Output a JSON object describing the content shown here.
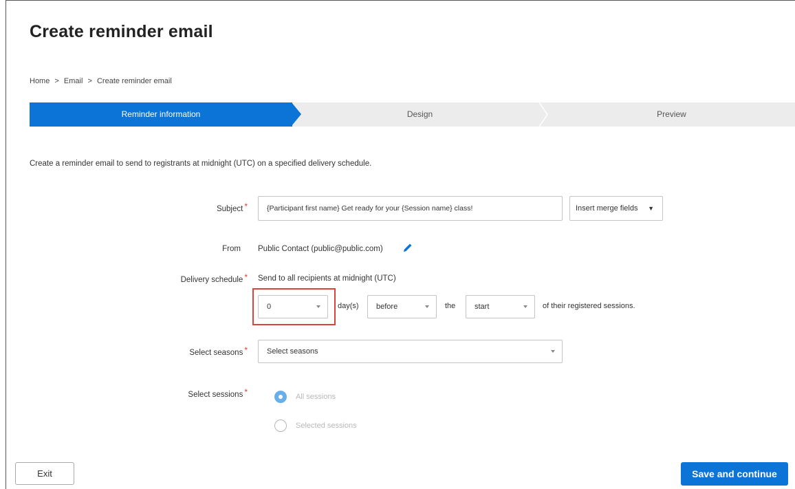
{
  "header": {
    "title": "Create reminder email"
  },
  "breadcrumb": {
    "items": [
      "Home",
      "Email",
      "Create reminder email"
    ],
    "separator": ">"
  },
  "stepper": {
    "steps": [
      {
        "label": "Reminder information",
        "active": true
      },
      {
        "label": "Design",
        "active": false
      },
      {
        "label": "Preview",
        "active": false
      }
    ]
  },
  "intro": "Create a reminder email to send to registrants at midnight (UTC) on a specified delivery schedule.",
  "form": {
    "subject": {
      "label": "Subject",
      "value": "{Participant first name} Get ready for your {Session name} class!",
      "merge_button": "Insert merge fields"
    },
    "from": {
      "label": "From",
      "value": "Public Contact (public@public.com)"
    },
    "delivery": {
      "label": "Delivery schedule",
      "description": "Send to all recipients at midnight (UTC)",
      "days_value": "0",
      "days_label": "day(s)",
      "relation_value": "before",
      "the_label": "the",
      "point_value": "start",
      "suffix": "of their registered sessions."
    },
    "seasons": {
      "label": "Select seasons",
      "placeholder": "Select seasons"
    },
    "sessions": {
      "label": "Select sessions",
      "options": [
        {
          "label": "All sessions",
          "checked": true
        },
        {
          "label": "Selected sessions",
          "checked": false
        }
      ]
    }
  },
  "footer": {
    "exit_label": "Exit",
    "save_label": "Save and continue"
  },
  "colors": {
    "primary": "#0b74d6",
    "required": "#e03a3a",
    "highlight": "#d9433a"
  }
}
